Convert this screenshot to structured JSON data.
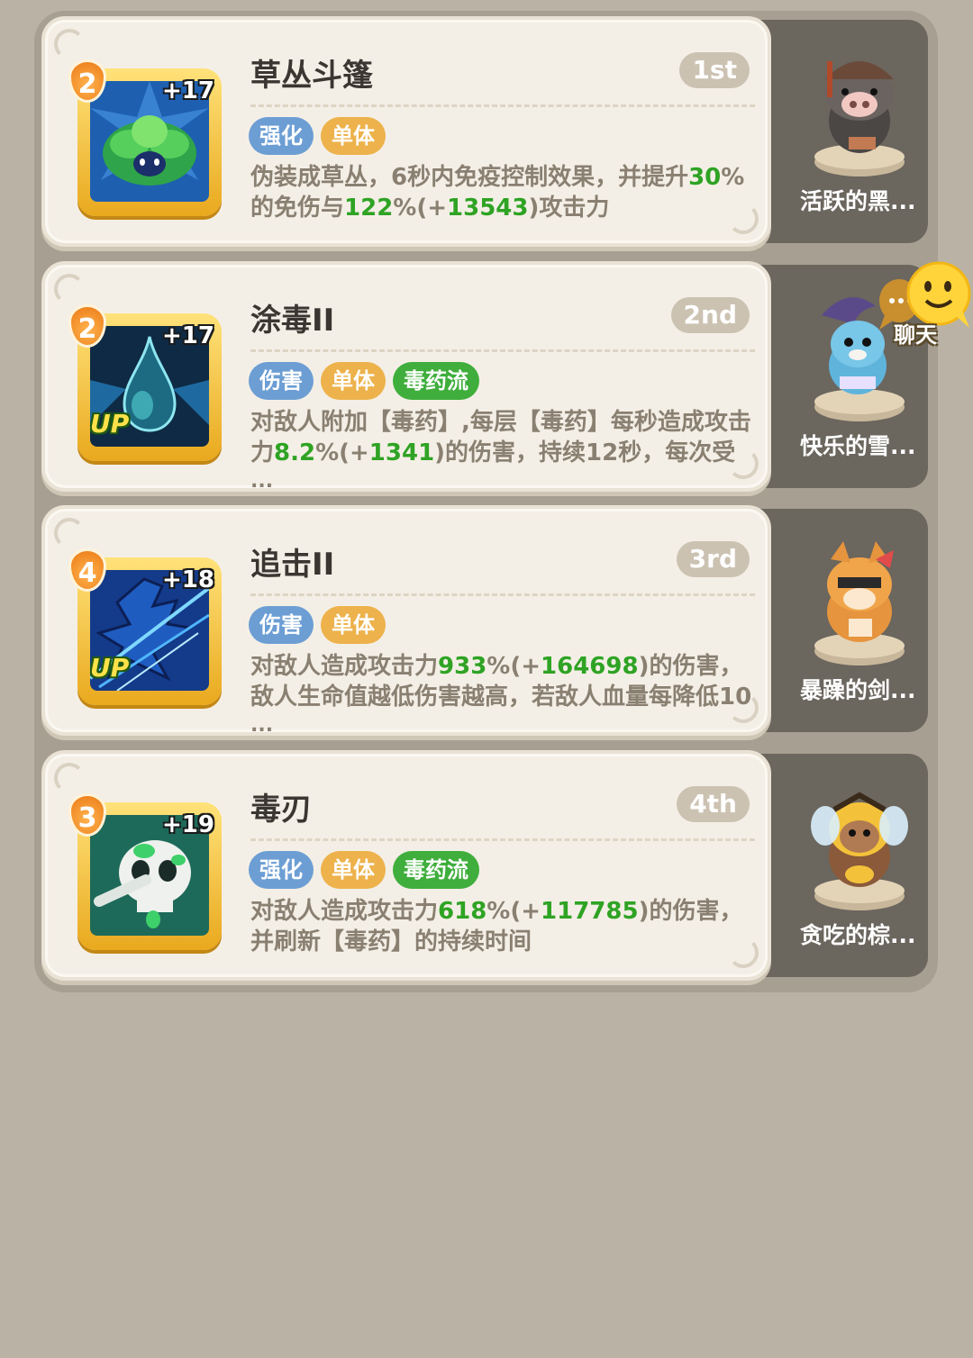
{
  "skills": [
    {
      "name": "草丛斗篷",
      "rank": "1st",
      "level": "2",
      "plus": "+17",
      "up": "",
      "icon": "leaf-cloak-icon",
      "tags": [
        {
          "label": "强化",
          "color": "blue"
        },
        {
          "label": "单体",
          "color": "yellow"
        }
      ],
      "desc": [
        {
          "t": "伪装成草丛，6秒内免疫控制效果，并提升",
          "g": false
        },
        {
          "t": "30",
          "g": true
        },
        {
          "t": "%的免伤与",
          "g": false
        },
        {
          "t": "122",
          "g": true
        },
        {
          "t": "%(+",
          "g": false
        },
        {
          "t": "13543",
          "g": true
        },
        {
          "t": ")攻击力",
          "g": false
        }
      ],
      "ellipsis": "",
      "hero": "活跃的黑...",
      "hero_icon": "boar-hero-icon"
    },
    {
      "name": "涂毒II",
      "rank": "2nd",
      "level": "2",
      "plus": "+17",
      "up": "UP",
      "icon": "poison-drop-icon",
      "tags": [
        {
          "label": "伤害",
          "color": "blue"
        },
        {
          "label": "单体",
          "color": "yellow"
        },
        {
          "label": "毒药流",
          "color": "green"
        }
      ],
      "desc": [
        {
          "t": "对敌人附加【毒药】,每层【毒药】每秒造成攻击力",
          "g": false
        },
        {
          "t": "8.2",
          "g": true
        },
        {
          "t": "%(+",
          "g": false
        },
        {
          "t": "1341",
          "g": true
        },
        {
          "t": ")的伤害，持续12秒，每次受",
          "g": false
        }
      ],
      "ellipsis": "...",
      "hero": "快乐的雪...",
      "hero_icon": "snow-beast-hero-icon"
    },
    {
      "name": "追击II",
      "rank": "3rd",
      "level": "4",
      "plus": "+18",
      "up": "UP",
      "icon": "pursuit-strike-icon",
      "tags": [
        {
          "label": "伤害",
          "color": "blue"
        },
        {
          "label": "单体",
          "color": "yellow"
        }
      ],
      "desc": [
        {
          "t": "对敌人造成攻击力",
          "g": false
        },
        {
          "t": "933",
          "g": true
        },
        {
          "t": "%(+",
          "g": false
        },
        {
          "t": "164698",
          "g": true
        },
        {
          "t": ")的伤害，敌人生命值越低伤害越高，若敌人血量每降低10",
          "g": false
        }
      ],
      "ellipsis": "...",
      "hero": "暴躁的剑...",
      "hero_icon": "tiger-swordsman-hero-icon"
    },
    {
      "name": "毒刃",
      "rank": "4th",
      "level": "3",
      "plus": "+19",
      "up": "",
      "icon": "poison-skull-icon",
      "tags": [
        {
          "label": "强化",
          "color": "blue"
        },
        {
          "label": "单体",
          "color": "yellow"
        },
        {
          "label": "毒药流",
          "color": "green"
        }
      ],
      "desc": [
        {
          "t": "对敌人造成攻击力",
          "g": false
        },
        {
          "t": "618",
          "g": true
        },
        {
          "t": "%(+",
          "g": false
        },
        {
          "t": "117785",
          "g": true
        },
        {
          "t": ")的伤害，并刷新【毒药】的持续时间",
          "g": false
        }
      ],
      "ellipsis": "",
      "hero": "贪吃的棕...",
      "hero_icon": "bee-bear-hero-icon"
    }
  ],
  "chat": {
    "label": "聊天",
    "icon": "chat-bubble-icon"
  }
}
